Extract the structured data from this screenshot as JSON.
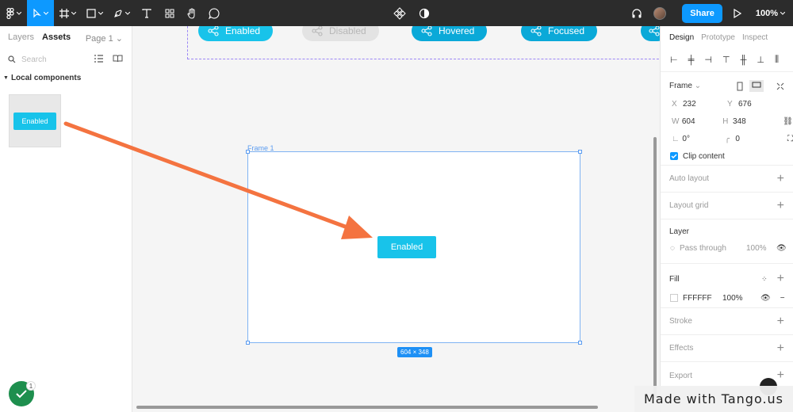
{
  "toolbar": {
    "share_label": "Share",
    "zoom_label": "100%",
    "tools": [
      "figma-menu-icon",
      "move-tool-icon",
      "frame-tool-icon",
      "shape-tool-icon",
      "pen-tool-icon",
      "text-tool-icon",
      "resources-icon",
      "hand-tool-icon",
      "comment-tool-icon"
    ]
  },
  "left_panel": {
    "tabs": [
      "Layers",
      "Assets"
    ],
    "page_label": "Page 1",
    "search_placeholder": "Search",
    "section_label": "Local components",
    "component_label": "Enabled",
    "notification_count": "1"
  },
  "canvas": {
    "variants": [
      {
        "label": "Enabled",
        "state": "enabled"
      },
      {
        "label": "Disabled",
        "state": "disabled"
      },
      {
        "label": "Hovered",
        "state": "hovered"
      },
      {
        "label": "Focused",
        "state": "focused"
      }
    ],
    "frame_label": "Frame 1",
    "frame_button_label": "Enabled",
    "size_tag": "604 × 348",
    "accent_color": "#18c3ea",
    "arrow_color": "#f47340"
  },
  "right_panel": {
    "tabs": [
      "Design",
      "Prototype",
      "Inspect"
    ],
    "frame_label": "Frame",
    "x_label": "X",
    "x_value": "232",
    "y_label": "Y",
    "y_value": "676",
    "w_label": "W",
    "w_value": "604",
    "h_label": "H",
    "h_value": "348",
    "rotation_value": "0°",
    "radius_value": "0",
    "clip_content_label": "Clip content",
    "auto_layout_label": "Auto layout",
    "layout_grid_label": "Layout grid",
    "layer_label": "Layer",
    "blend_mode": "Pass through",
    "layer_opacity": "100%",
    "fill_label": "Fill",
    "fill_hex": "FFFFFF",
    "fill_opacity": "100%",
    "stroke_label": "Stroke",
    "effects_label": "Effects",
    "export_label": "Export"
  },
  "watermark": "Made with Tango.us"
}
